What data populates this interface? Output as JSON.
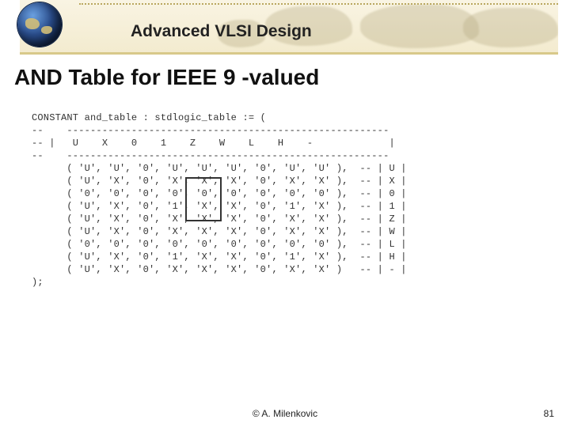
{
  "header": {
    "course_title": "Advanced VLSI Design"
  },
  "slide": {
    "title": "AND Table for IEEE 9 -valued"
  },
  "code": {
    "decl": "CONSTANT and_table : stdlogic_table := (",
    "rule_top": "--    -------------------------------------------------------",
    "header": "-- |   U    X    0    1    Z    W    L    H    -             |",
    "rule_mid": "--    -------------------------------------------------------",
    "rows": [
      "      ( 'U', 'U', '0', 'U', 'U', 'U', '0', 'U', 'U' ),  -- | U |",
      "      ( 'U', 'X', '0', 'X', 'X', 'X', '0', 'X', 'X' ),  -- | X |",
      "      ( '0', '0', '0', '0', '0', '0', '0', '0', '0' ),  -- | 0 |",
      "      ( 'U', 'X', '0', '1', 'X', 'X', '0', '1', 'X' ),  -- | 1 |",
      "      ( 'U', 'X', '0', 'X', 'X', 'X', '0', 'X', 'X' ),  -- | Z |",
      "      ( 'U', 'X', '0', 'X', 'X', 'X', '0', 'X', 'X' ),  -- | W |",
      "      ( '0', '0', '0', '0', '0', '0', '0', '0', '0' ),  -- | L |",
      "      ( 'U', 'X', '0', '1', 'X', 'X', '0', '1', 'X' ),  -- | H |",
      "      ( 'U', 'X', '0', 'X', 'X', 'X', '0', 'X', 'X' )   -- | - |"
    ],
    "close": ");"
  },
  "footer": {
    "author": "© A. Milenkovic",
    "page": "81"
  }
}
